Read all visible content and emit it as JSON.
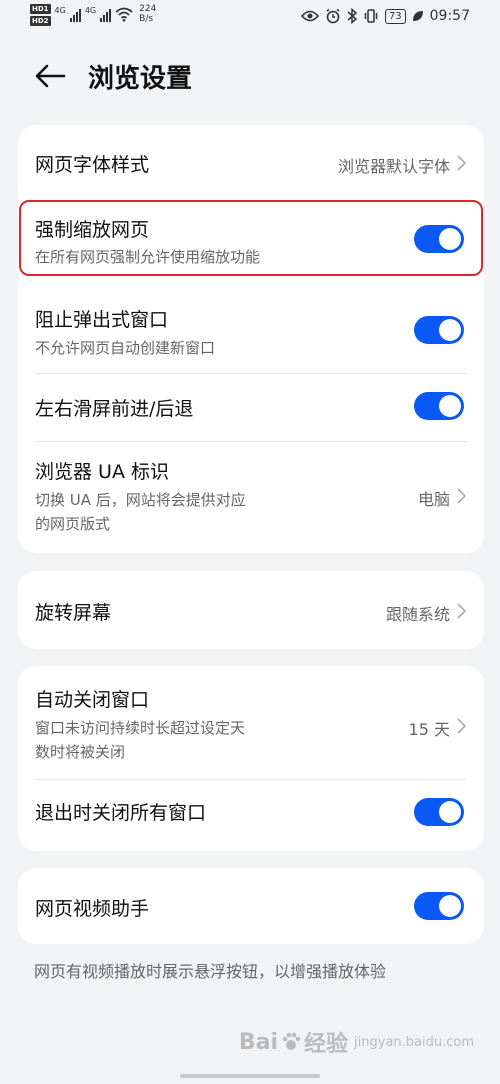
{
  "statusbar": {
    "sim1_tag": "HD1",
    "sim2_tag": "HD2",
    "net1": "4G",
    "net2": "4G",
    "speed_value": "224",
    "speed_unit": "B/s",
    "battery": "73",
    "time": "09:57"
  },
  "header": {
    "title": "浏览设置"
  },
  "card1": {
    "font_style": {
      "title": "网页字体样式",
      "value": "浏览器默认字体"
    },
    "force_zoom": {
      "title": "强制缩放网页",
      "subtitle": "在所有网页强制允许使用缩放功能",
      "on": true
    },
    "block_popup": {
      "title": "阻止弹出式窗口",
      "subtitle": "不允许网页自动创建新窗口",
      "on": true
    },
    "swipe_nav": {
      "title": "左右滑屏前进/后退",
      "on": true
    },
    "ua": {
      "title": "浏览器 UA 标识",
      "subtitle_line1": "切换 UA 后，网站将会提供对应",
      "subtitle_line2": "的网页版式",
      "value": "电脑"
    }
  },
  "card2": {
    "rotate": {
      "title": "旋转屏幕",
      "value": "跟随系统"
    }
  },
  "card3": {
    "auto_close": {
      "title": "自动关闭窗口",
      "subtitle_line1": "窗口未访问持续时长超过设定天",
      "subtitle_line2": "数时将被关闭",
      "value": "15 天"
    },
    "close_all": {
      "title": "退出时关闭所有窗口",
      "on": true
    }
  },
  "card4": {
    "video_helper": {
      "title": "网页视频助手",
      "on": true
    }
  },
  "footer_note": "网页有视频播放时展示悬浮按钮，以增强播放体验",
  "watermark": {
    "brand": "Bai",
    "brand2": "经验",
    "sub": "jingyan.baidu.com"
  },
  "colors": {
    "accent": "#0a59f7",
    "highlight": "#d9282f",
    "background": "#f1f3f5"
  }
}
